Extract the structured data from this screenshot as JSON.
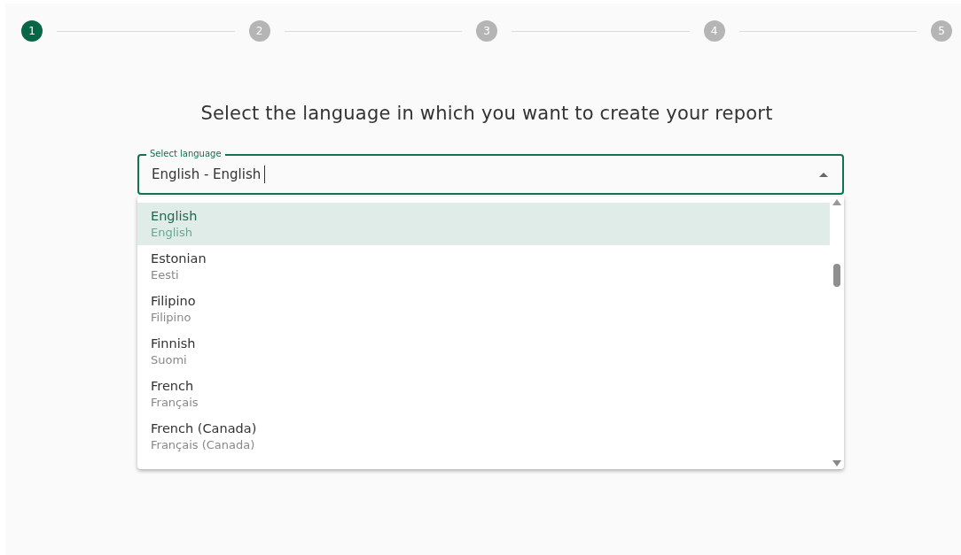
{
  "stepper": [
    {
      "number": "1",
      "selected": true
    },
    {
      "number": "2",
      "selected": false
    },
    {
      "number": "3",
      "selected": false
    },
    {
      "number": "4",
      "selected": false
    },
    {
      "number": "5",
      "selected": false
    }
  ],
  "heading": "Select the language in which you want to create your report",
  "language_field": {
    "label": "Select language",
    "value": "English - English"
  },
  "language_options": [
    {
      "name": "English",
      "native": "English",
      "selected": true
    },
    {
      "name": "Estonian",
      "native": "Eesti",
      "selected": false
    },
    {
      "name": "Filipino",
      "native": "Filipino",
      "selected": false
    },
    {
      "name": "Finnish",
      "native": "Suomi",
      "selected": false
    },
    {
      "name": "French",
      "native": "Français",
      "selected": false
    },
    {
      "name": "French (Canada)",
      "native": "Français (Canada)",
      "selected": false
    }
  ]
}
